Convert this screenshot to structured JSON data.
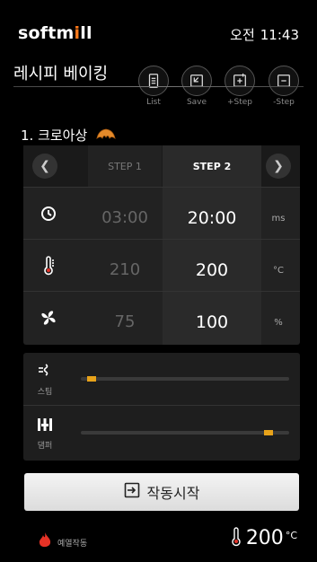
{
  "brand": {
    "name_part1": "softm",
    "name_accent": "i",
    "name_part2": "ll"
  },
  "status": {
    "ampm": "오전",
    "time": "11:43"
  },
  "page_title": "레시피 베이킹",
  "toolbar": {
    "list_label": "List",
    "save_label": "Save",
    "add_step_label": "+Step",
    "remove_step_label": "-Step"
  },
  "recipe": {
    "name": "1. 크로아상"
  },
  "steps": {
    "prev_icon": "chevron-left-icon",
    "next_icon": "chevron-right-icon",
    "step1_label": "STEP 1",
    "step2_label": "STEP 2",
    "time": {
      "step1": "03:00",
      "step2": "20:00",
      "unit": "ms"
    },
    "temperature": {
      "step1": "210",
      "step2": "200",
      "unit": "°C"
    },
    "fan": {
      "step1": "75",
      "step2": "100",
      "unit": "%"
    }
  },
  "controls": {
    "steam_label": "스팀",
    "damper_label": "댐퍼",
    "steam_level": 0.03,
    "damper_level": 0.92,
    "accent": "#e8a31a"
  },
  "start_button": {
    "label": "작동시작"
  },
  "footer": {
    "preheat_label": "예열작동",
    "current_temp": "200",
    "current_temp_unit": "°C"
  }
}
